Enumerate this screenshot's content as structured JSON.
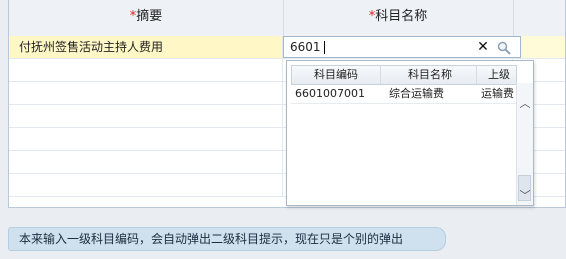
{
  "grid": {
    "headers": [
      {
        "required_mark": "*",
        "label": "摘要"
      },
      {
        "required_mark": "*",
        "label": "科目名称"
      }
    ],
    "rows": [
      {
        "summary": "付抚州签售活动主持人费用",
        "account": ""
      },
      {
        "summary": "",
        "account": ""
      },
      {
        "summary": "",
        "account": ""
      },
      {
        "summary": "",
        "account": ""
      },
      {
        "summary": "",
        "account": ""
      },
      {
        "summary": "",
        "account": ""
      },
      {
        "summary": "",
        "account": ""
      }
    ]
  },
  "account_input": {
    "value": "6601",
    "clear_icon": "close-icon",
    "search_icon": "search-icon"
  },
  "dropdown": {
    "columns": [
      "科目编码",
      "科目名称",
      "上级"
    ],
    "rows": [
      {
        "code": "6601007001",
        "name": "综合运输费",
        "parent": "运输费"
      }
    ]
  },
  "tip": {
    "text": "本来输入一级科目编码，会自动弹出二级科目提示，现在只是个别的弹出"
  },
  "colors": {
    "required": "#e02020",
    "active_row": "#fffbd8",
    "tip_bg": "#cfe0ee"
  }
}
